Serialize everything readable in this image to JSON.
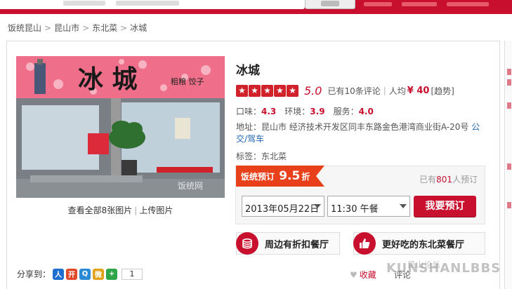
{
  "breadcrumb": [
    "饭统昆山",
    "昆山市",
    "东北菜",
    "冰城"
  ],
  "shop": {
    "name": "冰城",
    "score": "5.0",
    "reviews": "已有10条评论",
    "avg_label": "人均",
    "avg_price": "¥ 40",
    "trend": "[趋势]",
    "taste_label": "口味：",
    "taste": "4.3",
    "env_label": "环境：",
    "env": "3.9",
    "service_label": "服务：",
    "service": "4.0",
    "address_label": "地址：",
    "address": "昆山市 经济技术开发区同丰东路金色港湾商业街A-20号",
    "address_link": "公交/驾车",
    "tags_label": "标签：",
    "tags": "东北菜",
    "sign_text": "冰 城",
    "sign_subtext": "粗粮 饺子"
  },
  "photo": {
    "view_all": "查看全部8张图片",
    "upload": "上传图片"
  },
  "booking": {
    "promo_label": "饭统预订",
    "discount": "9.5",
    "discount_unit": "折",
    "booked_prefix": "已有",
    "booked_count": "801",
    "booked_suffix": "人预订",
    "date": "2013年05月22日",
    "time": "11:30 午餐",
    "book_button": "我要预订"
  },
  "promo_buttons": {
    "nearby_discount": "周边有折扣餐厅",
    "better_northeast": "更好吃的东北菜餐厅"
  },
  "share": {
    "label": "分享到：",
    "count": "1",
    "favorite": "收藏",
    "review": "评论"
  },
  "watermark": {
    "main": "KUNSHANLBBS",
    "small": "昆山论坛"
  },
  "colors": {
    "brand_red": "#c8102e",
    "link_blue": "#2265b5"
  }
}
